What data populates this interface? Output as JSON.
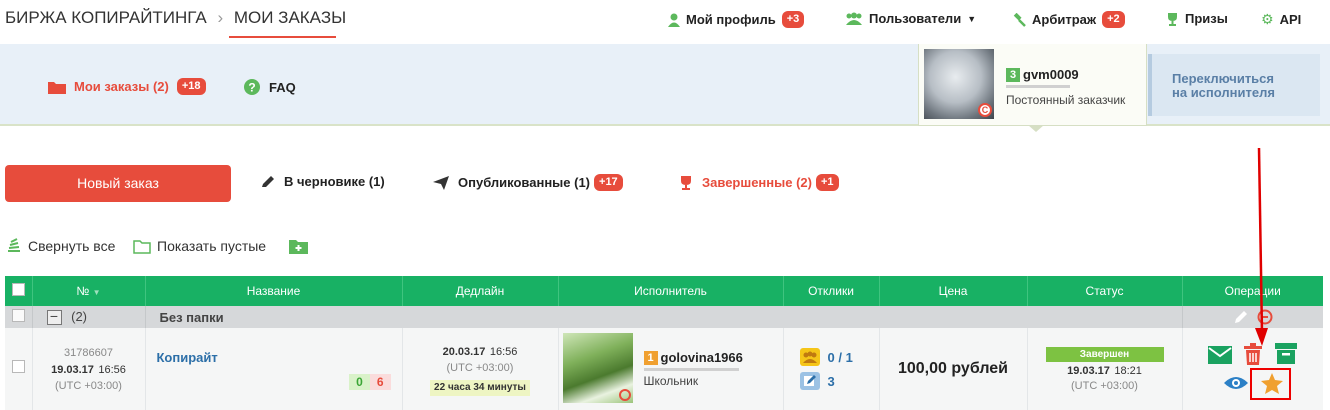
{
  "header": {
    "breadcrumb_root": "БИРЖА КОПИРАЙТИНГА",
    "breadcrumb_sep": "›",
    "breadcrumb_current": "МОИ ЗАКАЗЫ",
    "nav": {
      "profile_label": "Мой профиль",
      "profile_badge": "+3",
      "users_label": "Пользователи",
      "arbitration_label": "Арбитраж",
      "arbitration_badge": "+2",
      "prizes_label": "Призы",
      "api_label": "API"
    }
  },
  "band": {
    "my_orders_label": "Мои заказы (2)",
    "my_orders_badge": "+18",
    "faq_label": "FAQ",
    "profile": {
      "level": "3",
      "username": "gvm0009",
      "role": "Постоянный заказчик",
      "avatar_mark": "C"
    },
    "switch_line1": "Переключиться",
    "switch_line2": "на исполнителя"
  },
  "orders_bar": {
    "new_order": "Новый заказ",
    "drafts": "В черновике (1)",
    "published": "Опубликованные (1)",
    "published_badge": "+17",
    "completed": "Завершенные (2)",
    "completed_badge": "+1"
  },
  "tools": {
    "collapse_all": "Свернуть все",
    "show_empty": "Показать пустые"
  },
  "table": {
    "columns": [
      "№",
      "Название",
      "Дедлайн",
      "Исполнитель",
      "Отклики",
      "Цена",
      "Статус",
      "Операции"
    ],
    "folder": {
      "count": "(2)",
      "name": "Без папки"
    },
    "row": {
      "id": "31786607",
      "created_date": "19.03.17",
      "created_time": "16:56",
      "created_tz": "(UTC +03:00)",
      "title": "Копирайт",
      "stat_green": "0",
      "stat_red": "6",
      "deadline_date": "20.03.17",
      "deadline_time": "16:56",
      "deadline_tz": "(UTC +03:00)",
      "deadline_left": "22 часа 34 минуты",
      "executor_level": "1",
      "executor_name": "golovina1966",
      "executor_role": "Школьник",
      "responses": "0 / 1",
      "edits": "3",
      "price": "100,00 рублей",
      "status": "Завершен",
      "status_date": "19.03.17",
      "status_time": "18:21",
      "status_tz": "(UTC +03:00)"
    }
  },
  "colors": {
    "accent_red": "#e74c3c",
    "table_header_green": "#18b164",
    "status_green": "#7dc242",
    "annotation_red": "#e00000"
  }
}
